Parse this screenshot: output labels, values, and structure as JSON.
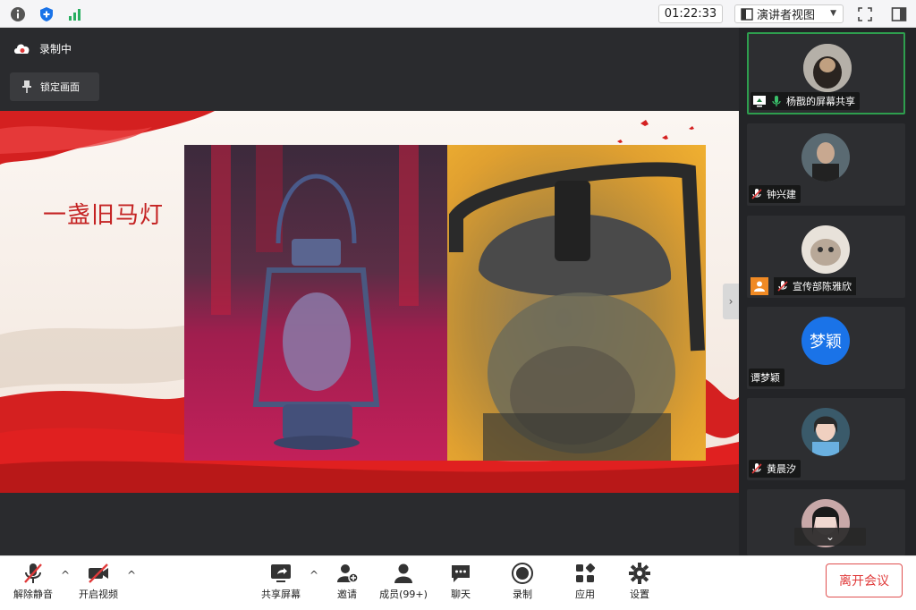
{
  "topbar": {
    "timer": "01:22:33",
    "view_mode": "演讲者视图",
    "icons": [
      "info-icon",
      "shield-icon",
      "signal-icon",
      "fullscreen-icon",
      "sidebar-toggle-icon"
    ],
    "accent_green": "#27ae60"
  },
  "stage": {
    "recording_label": "录制中",
    "lock_label": "锁定画面",
    "slide_title": "一盏旧马灯",
    "slide_accent": "#c42222"
  },
  "participants": [
    {
      "name": "杨戬的屏幕共享",
      "sharing": true,
      "avatar_kind": "photo-dog"
    },
    {
      "name": "钟兴建",
      "muted": true,
      "avatar_kind": "photo-man"
    },
    {
      "name": "宣传部陈雅欣",
      "muted": true,
      "avatar_kind": "photo-cat",
      "badge": "user-icon"
    },
    {
      "name": "谭梦颖",
      "avatar_text": "梦颖",
      "avatar_color": "#1a73e8"
    },
    {
      "name": "黄晨汐",
      "muted": true,
      "avatar_kind": "photo-girl"
    },
    {
      "name": "",
      "avatar_kind": "photo-partial"
    }
  ],
  "toolbar": {
    "unmute": "解除静音",
    "start_video": "开启视频",
    "share_screen": "共享屏幕",
    "invite": "邀请",
    "members": "成员(99+)",
    "chat": "聊天",
    "record": "录制",
    "apps": "应用",
    "settings": "设置",
    "leave": "离开会议",
    "leave_color": "#e03a3a"
  }
}
